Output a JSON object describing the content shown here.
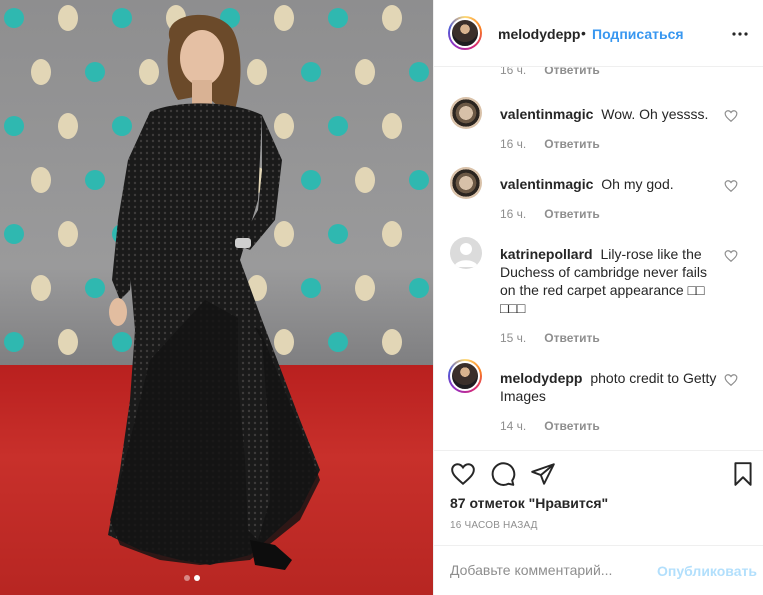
{
  "colors": {
    "link_blue": "#3897f0",
    "publish_disabled": "#b2dffc",
    "text_primary": "#262626",
    "text_secondary": "#8e8e8e",
    "border": "#efefef",
    "carpet_red": "#c8302b"
  },
  "photo": {
    "carousel": {
      "slides": 2,
      "active_index": 1
    }
  },
  "header": {
    "username": "melodydepp",
    "separator": "•",
    "follow_label": "Подписаться",
    "more_icon": "more-horizontal-icon"
  },
  "comments": [
    {
      "username": "",
      "text": "",
      "time": "16 ч.",
      "reply_label": "Ответить"
    },
    {
      "username": "valentinmagic",
      "text": "Wow. Oh yessss.",
      "time": "16 ч.",
      "reply_label": "Ответить"
    },
    {
      "username": "valentinmagic",
      "text": "Oh my god.",
      "time": "16 ч.",
      "reply_label": "Ответить"
    },
    {
      "username": "katrinepollard",
      "text": "Lily-rose like the Duchess of cambridge never fails on the red carpet appearance □□ □□□",
      "time": "15 ч.",
      "reply_label": "Ответить"
    },
    {
      "username": "melodydepp",
      "text": "photo credit to Getty Images",
      "time": "14 ч.",
      "reply_label": "Ответить"
    }
  ],
  "actions": {
    "icons": [
      "heart-icon",
      "comment-icon",
      "share-icon",
      "bookmark-icon"
    ],
    "likes_text": "87 отметок \"Нравится\"",
    "posted_time": "16 часов назад"
  },
  "add_comment": {
    "placeholder": "Добавьте комментарий...",
    "publish_label": "Опубликовать"
  }
}
